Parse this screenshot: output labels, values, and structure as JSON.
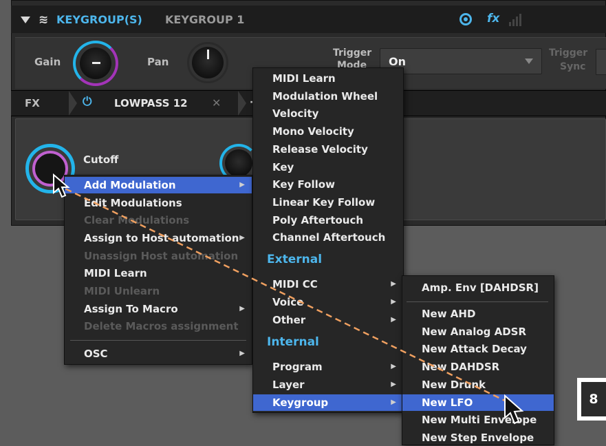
{
  "header": {
    "section": "KEYGROUP(S)",
    "keygroup": "KEYGROUP 1",
    "fx": "fx"
  },
  "params": {
    "gain_label": "Gain",
    "pan_label": "Pan",
    "trigger_mode_label": "Trigger",
    "trigger_mode_partial": "Mode",
    "trigger_value": "On",
    "trigger_sync_label": "Trigger",
    "trigger_sync_label2": "Sync"
  },
  "fxbar": {
    "label": "FX",
    "effect": "LOWPASS 12",
    "close": "✕",
    "add": "+"
  },
  "fxcontent": {
    "cutoff_label": "Cutoff"
  },
  "context_menu": {
    "items": [
      {
        "label": "Add Modulation",
        "enabled": true,
        "highlighted": true,
        "submenu": true
      },
      {
        "label": "Edit Modulations",
        "enabled": true
      },
      {
        "label": "Clear Modulations",
        "enabled": false
      },
      {
        "label": "Assign to Host automation",
        "enabled": true,
        "submenu": true
      },
      {
        "label": "Unassign Host automation",
        "enabled": false
      },
      {
        "label": "MIDI Learn",
        "enabled": true
      },
      {
        "label": "MIDI Unlearn",
        "enabled": false
      },
      {
        "label": "Assign To Macro",
        "enabled": true,
        "submenu": true
      },
      {
        "label": "Delete Macros assignment",
        "enabled": false
      },
      {
        "label": "OSC",
        "enabled": true,
        "submenu": true
      }
    ]
  },
  "modulation_menu": {
    "top_items": [
      "MIDI Learn",
      "Modulation Wheel",
      "Velocity",
      "Mono Velocity",
      "Release Velocity",
      "Key",
      "Key Follow",
      "Linear Key Follow",
      "Poly Aftertouch",
      "Channel Aftertouch"
    ],
    "external_header": "External",
    "external_items": [
      "MIDI CC",
      "Voice",
      "Other"
    ],
    "internal_header": "Internal",
    "internal_items": [
      "Program",
      "Layer",
      "Keygroup"
    ]
  },
  "keygroup_menu": {
    "top_item": "Amp. Env [DAHDSR]",
    "items": [
      "New AHD",
      "New Analog ADSR",
      "New Attack Decay",
      "New DAHDSR",
      "New Drunk",
      "New LFO",
      "New Multi Envelope",
      "New Step Envelope"
    ],
    "highlighted": "New LFO"
  },
  "badge": "8",
  "colors": {
    "accent_blue": "#3f67d0",
    "header_blue": "#4db6ec",
    "knob_ring_cyan": "#23b4ea",
    "knob_ring_magenta": "#a334b8",
    "dash_orange": "#f0a060"
  }
}
